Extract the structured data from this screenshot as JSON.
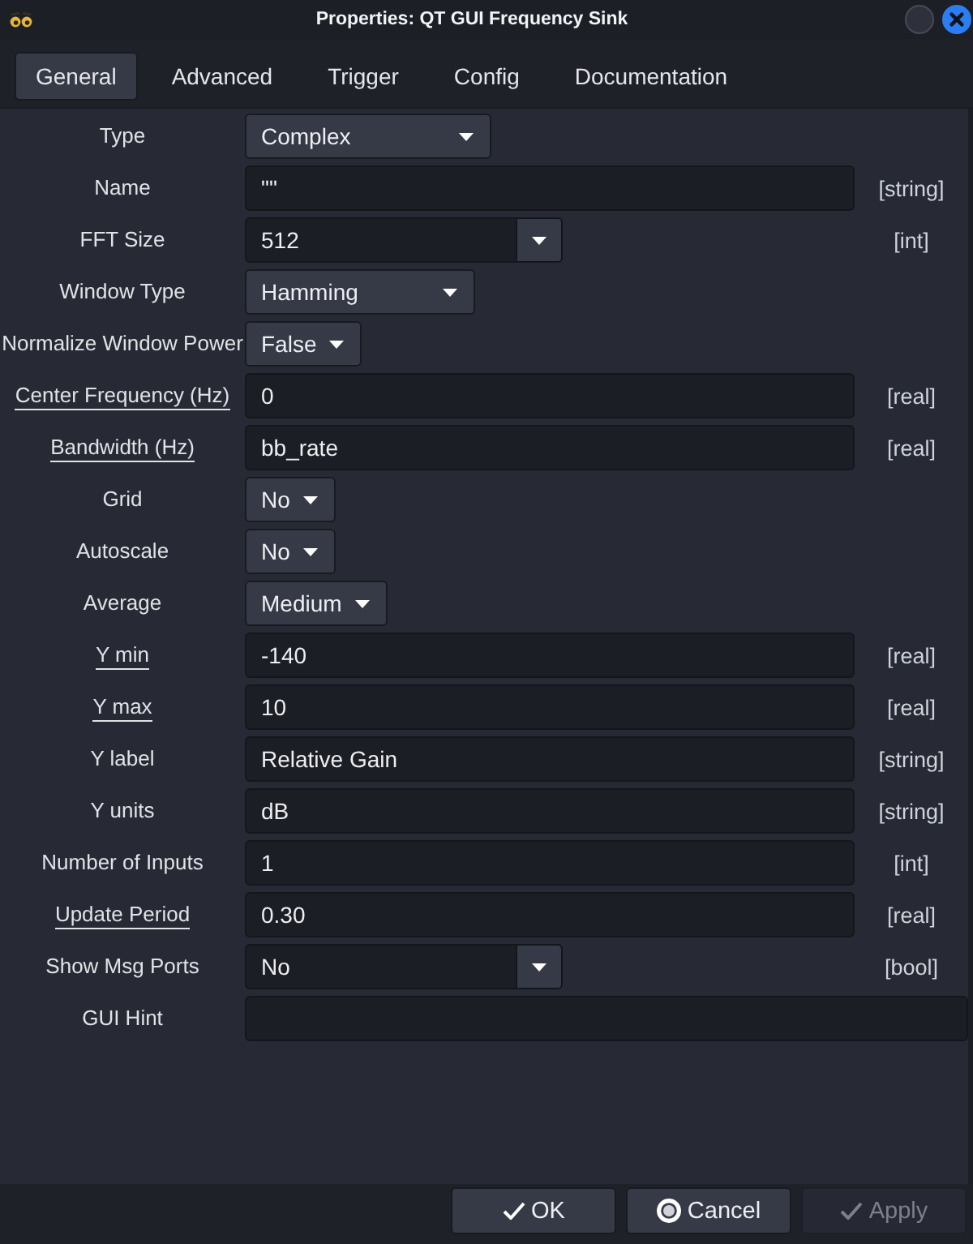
{
  "window": {
    "title": "Properties: QT GUI Frequency Sink"
  },
  "tabs": [
    {
      "label": "General",
      "selected": true
    },
    {
      "label": "Advanced",
      "selected": false
    },
    {
      "label": "Trigger",
      "selected": false
    },
    {
      "label": "Config",
      "selected": false
    },
    {
      "label": "Documentation",
      "selected": false
    }
  ],
  "params": [
    {
      "label": "Type",
      "underlined": false,
      "kind": "combo",
      "value": "Complex"
    },
    {
      "label": "Name",
      "underlined": false,
      "kind": "entry",
      "value": "\"\"",
      "type_hint": "[string]"
    },
    {
      "label": "FFT Size",
      "underlined": false,
      "kind": "editable_combo",
      "value": "512",
      "type_hint": "[int]"
    },
    {
      "label": "Window Type",
      "underlined": false,
      "kind": "combo",
      "value": "Hamming"
    },
    {
      "label": "Normalize Window Power",
      "underlined": false,
      "kind": "combo",
      "value": "False"
    },
    {
      "label": "Center Frequency (Hz)",
      "underlined": true,
      "kind": "entry",
      "value": "0",
      "type_hint": "[real]"
    },
    {
      "label": "Bandwidth (Hz)",
      "underlined": true,
      "kind": "entry",
      "value": "bb_rate",
      "type_hint": "[real]"
    },
    {
      "label": "Grid",
      "underlined": false,
      "kind": "combo",
      "value": "No"
    },
    {
      "label": "Autoscale",
      "underlined": false,
      "kind": "combo",
      "value": "No"
    },
    {
      "label": "Average",
      "underlined": false,
      "kind": "combo",
      "value": "Medium"
    },
    {
      "label": "Y min",
      "underlined": true,
      "kind": "entry",
      "value": "-140",
      "type_hint": "[real]"
    },
    {
      "label": "Y max",
      "underlined": true,
      "kind": "entry",
      "value": "10",
      "type_hint": "[real]"
    },
    {
      "label": "Y label",
      "underlined": false,
      "kind": "entry",
      "value": "Relative Gain",
      "type_hint": "[string]"
    },
    {
      "label": "Y units",
      "underlined": false,
      "kind": "entry",
      "value": "dB",
      "type_hint": "[string]"
    },
    {
      "label": "Number of Inputs",
      "underlined": false,
      "kind": "entry",
      "value": "1",
      "type_hint": "[int]"
    },
    {
      "label": "Update Period",
      "underlined": true,
      "kind": "entry",
      "value": "0.30",
      "type_hint": "[real]"
    },
    {
      "label": "Show Msg Ports",
      "underlined": false,
      "kind": "editable_combo",
      "value": "No",
      "type_hint": "[bool]"
    },
    {
      "label": "GUI Hint",
      "underlined": false,
      "kind": "wide_entry"
    }
  ],
  "buttons": [
    {
      "label": "OK",
      "kind": "confirm",
      "disabled": false
    },
    {
      "label": "Cancel",
      "kind": "cancel",
      "disabled": false
    },
    {
      "label": "Apply",
      "kind": "confirm",
      "disabled": true
    }
  ]
}
